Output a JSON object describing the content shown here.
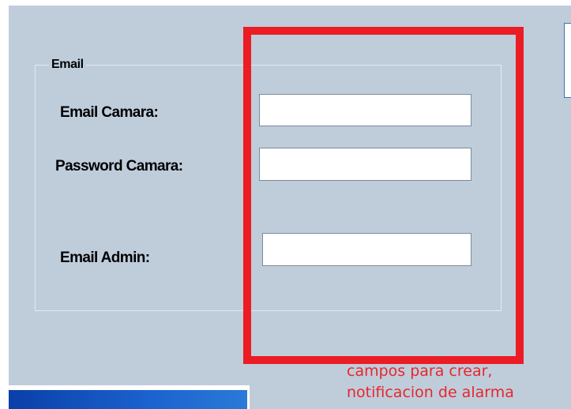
{
  "email_group": {
    "legend": "Email",
    "fields": {
      "email_camara": {
        "label": "Email Camara:",
        "value": ""
      },
      "password_camara": {
        "label": "Password Camara:",
        "value": ""
      },
      "email_admin": {
        "label": "Email Admin:",
        "value": ""
      }
    }
  },
  "annotation": {
    "line1": "campos para crear,",
    "line2": "notificacion de alarma",
    "color": "#ec1c24"
  },
  "colors": {
    "panel_background": "#bfcddb",
    "input_border": "#7a8a9a",
    "title_bar": "#1b63cf"
  }
}
